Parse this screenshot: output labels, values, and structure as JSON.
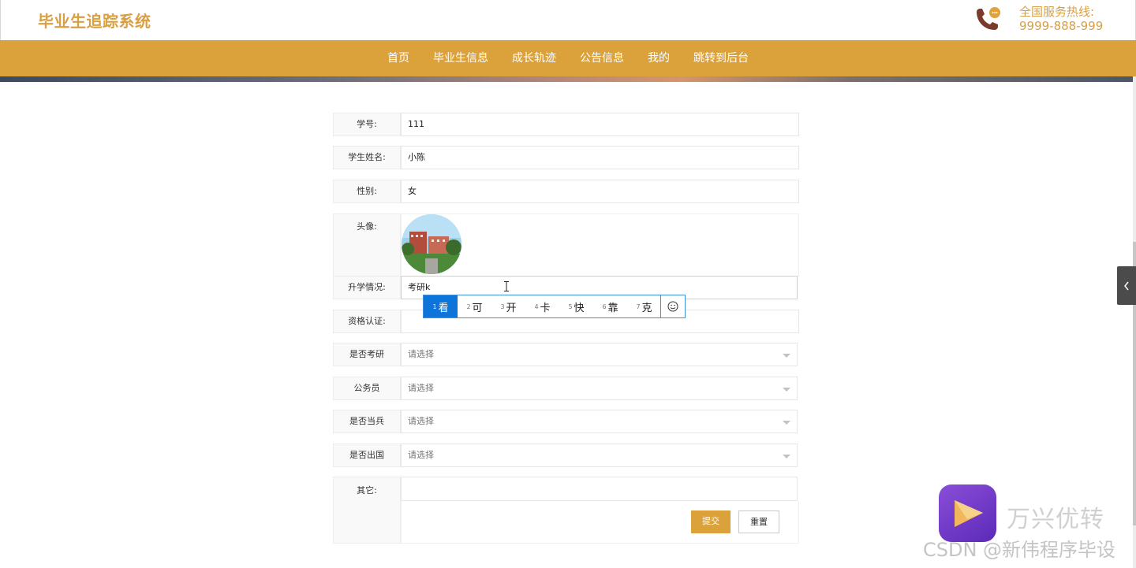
{
  "header": {
    "logo": "毕业生追踪系统",
    "hotline_label": "全国服务热线:",
    "hotline_number": "9999-888-999",
    "hotline_icon": "phone-chat-icon",
    "brand_color": "#d8a043"
  },
  "nav": {
    "items": [
      {
        "label": "首页"
      },
      {
        "label": "毕业生信息"
      },
      {
        "label": "成长轨迹"
      },
      {
        "label": "公告信息"
      },
      {
        "label": "我的"
      },
      {
        "label": "跳转到后台"
      }
    ],
    "bg_color": "#dba23c"
  },
  "form": {
    "student_id": {
      "label": "学号:",
      "value": "111"
    },
    "student_name": {
      "label": "学生姓名:",
      "value": "小陈"
    },
    "gender": {
      "label": "性别:",
      "value": "女"
    },
    "avatar": {
      "label": "头像:"
    },
    "further_study": {
      "label": "升学情况:",
      "value": "考研k"
    },
    "qualification": {
      "label": "资格认证:",
      "value": ""
    },
    "postgrad": {
      "label": "是否考研",
      "placeholder": "请选择"
    },
    "civil_servant": {
      "label": "公务员",
      "placeholder": "请选择"
    },
    "soldier": {
      "label": "是否当兵",
      "placeholder": "请选择"
    },
    "abroad": {
      "label": "是否出国",
      "placeholder": "请选择"
    },
    "other": {
      "label": "其它:",
      "value": ""
    },
    "submit_label": "提交",
    "reset_label": "重置"
  },
  "ime": {
    "candidates": [
      {
        "num": "1",
        "text": "看"
      },
      {
        "num": "2",
        "text": "可"
      },
      {
        "num": "3",
        "text": "开"
      },
      {
        "num": "4",
        "text": "卡"
      },
      {
        "num": "5",
        "text": "快"
      },
      {
        "num": "6",
        "text": "靠"
      },
      {
        "num": "7",
        "text": "克"
      }
    ],
    "emoji_icon": "smiley-icon"
  },
  "watermark": {
    "app_name": "万兴优转",
    "csdn": "CSDN @新伟程序毕设"
  }
}
